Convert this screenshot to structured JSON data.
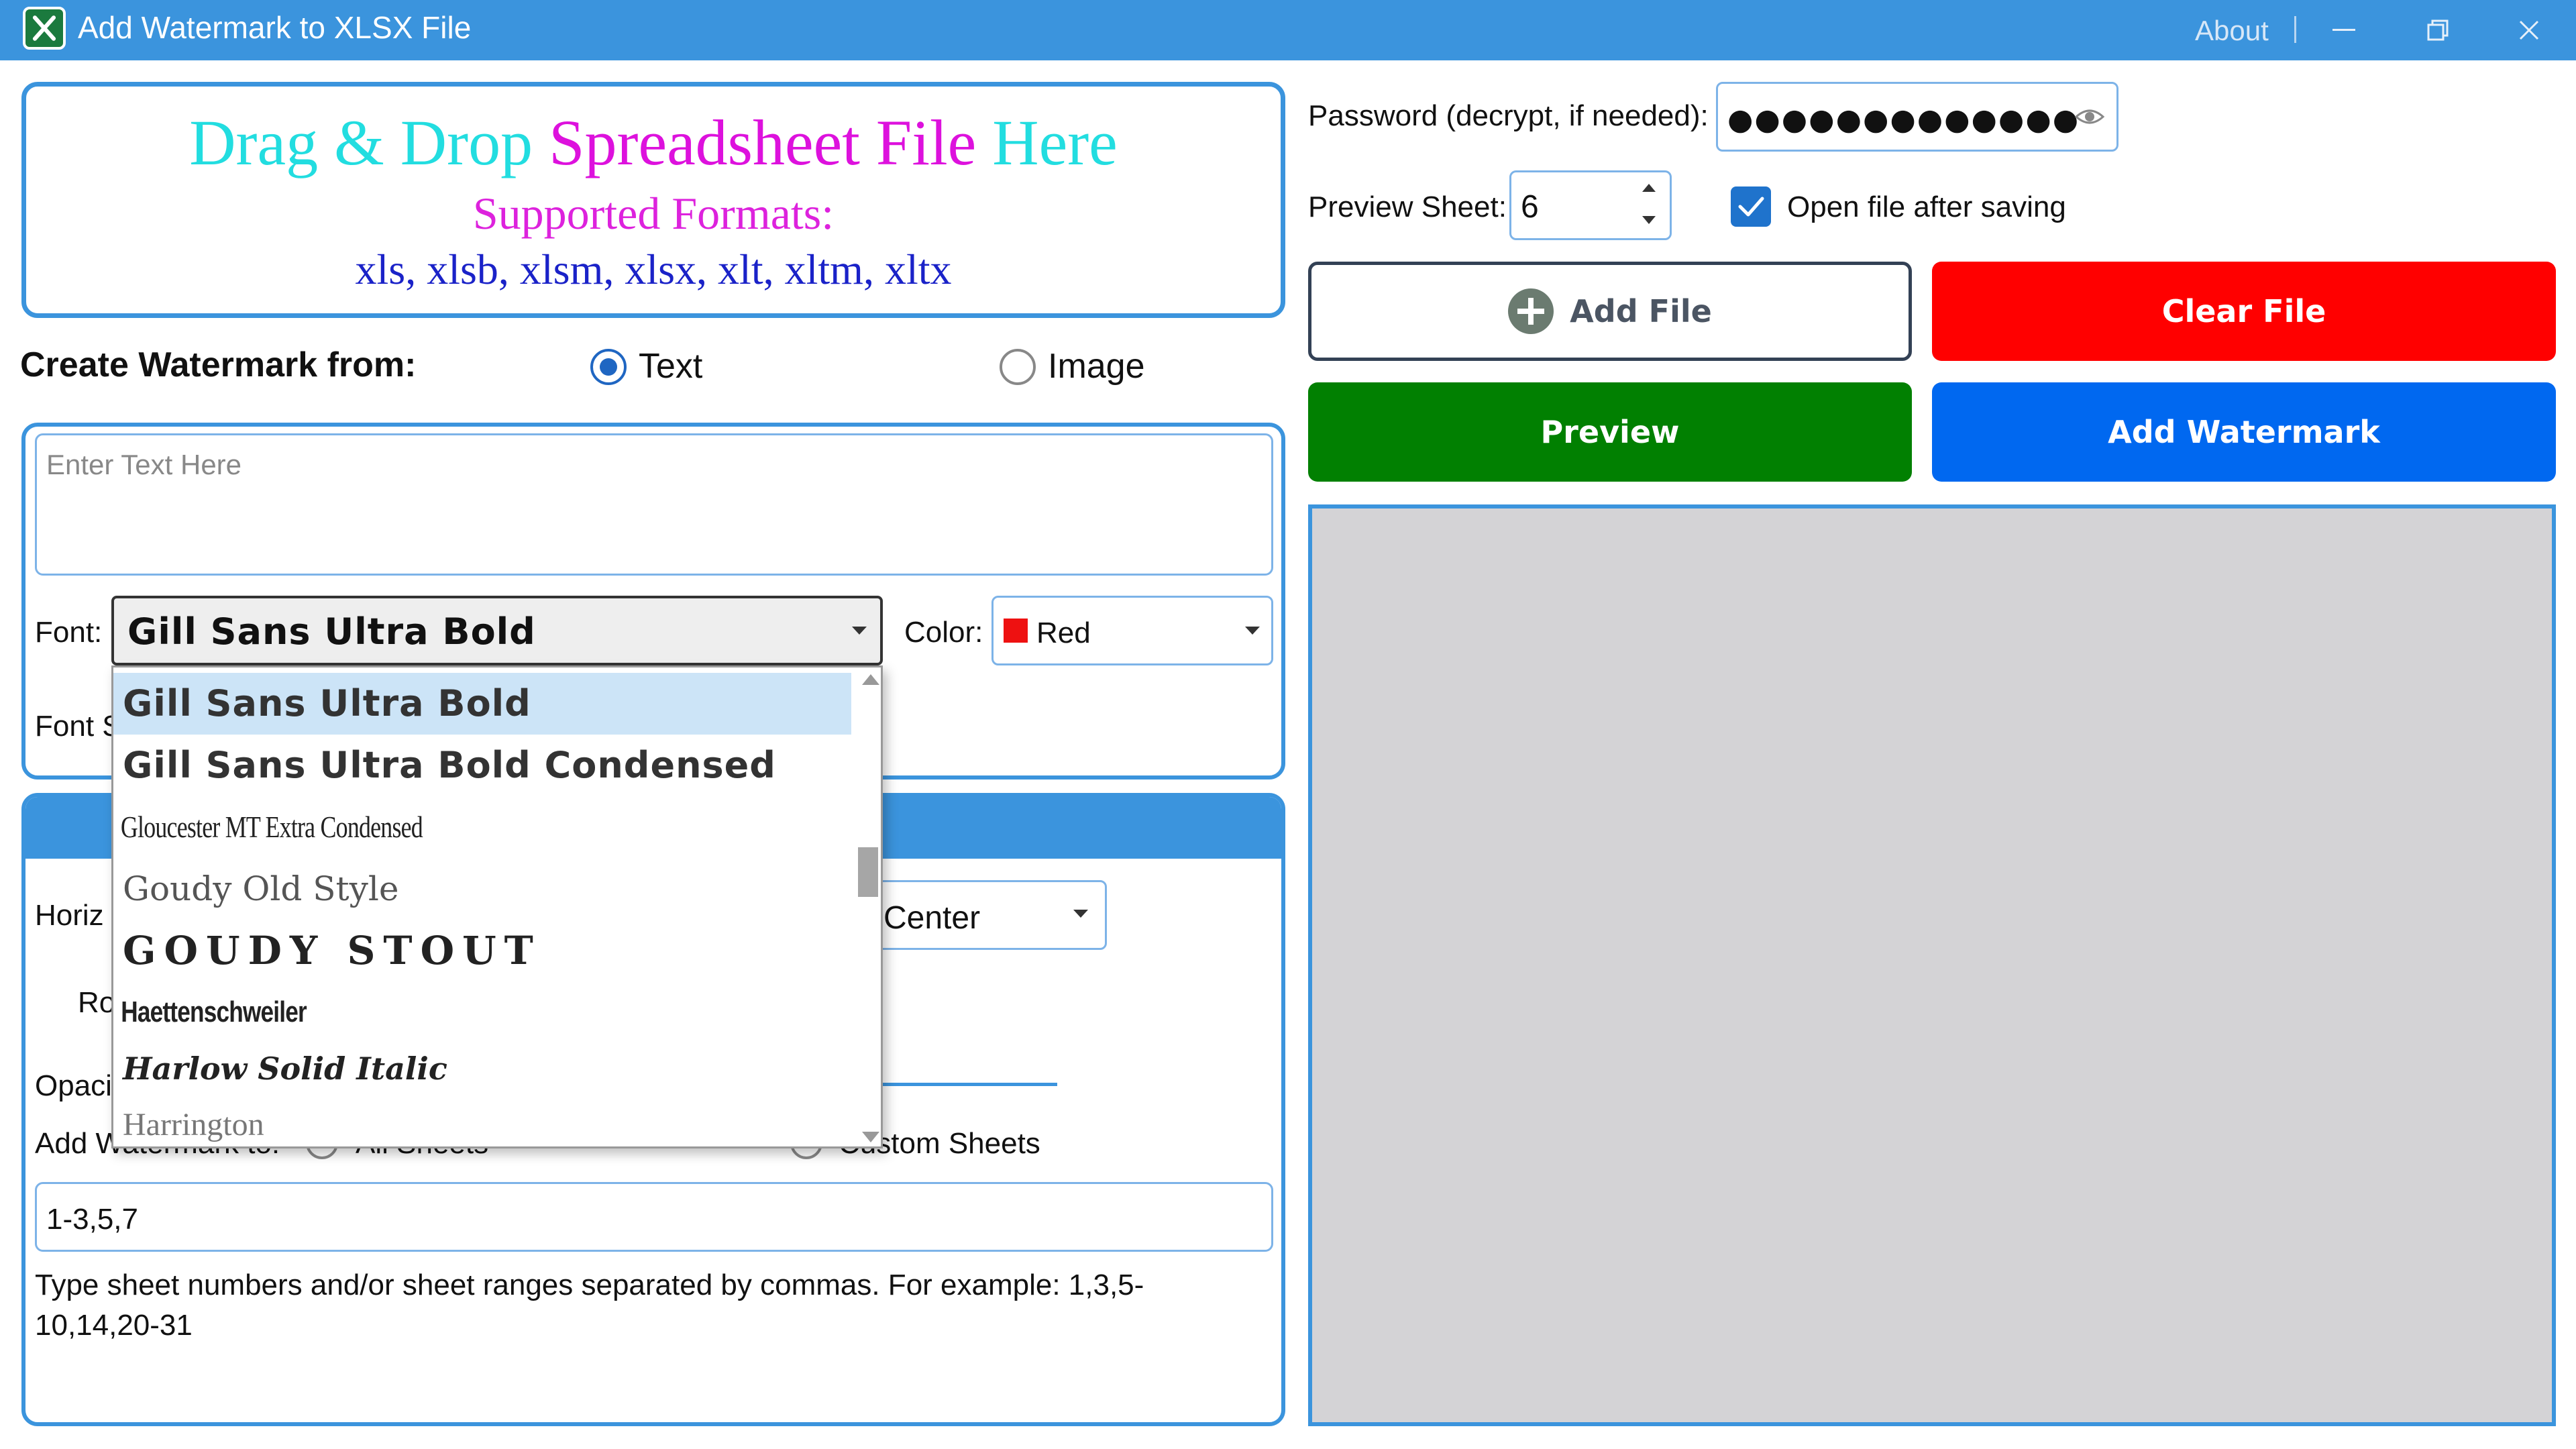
{
  "window": {
    "title": "Add Watermark to XLSX File",
    "about": "About"
  },
  "dropzone": {
    "part_drag": "Drag & Drop",
    "part_file": "Spreadsheet File",
    "part_here": "Here",
    "supported": "Supported Formats:",
    "formats": "xls, xlsb, xlsm, xlsx, xlt, xltm, xltx"
  },
  "watermark_source": {
    "label": "Create Watermark from:",
    "option_text": "Text",
    "option_image": "Image",
    "selected": "Text"
  },
  "text_settings": {
    "text_placeholder": "Enter Text Here",
    "font_label": "Font:",
    "font_value": "Gill Sans Ultra Bold",
    "color_label": "Color:",
    "color_value": "Red",
    "color_swatch": "#ee1111",
    "font_size_label": "Font S"
  },
  "font_dropdown": {
    "items": [
      "Gill Sans Ultra Bold",
      "Gill Sans Ultra Bold Condensed",
      "Gloucester MT Extra Condensed",
      "Goudy Old Style",
      "GOUDY STOUT",
      "Haettenschweiler",
      "Harlow Solid Italic",
      "Harrington"
    ],
    "selected_index": 0
  },
  "layout": {
    "horizontal_label": "Horiz",
    "horizontal_value": "Center",
    "rotation_label": "Ro",
    "opacity_label": "Opaci",
    "add_to_label": "Add Watermark to:",
    "option_all": "All Sheets",
    "option_custom": "Custom Sheets",
    "sheets_value": "1-3,5,7",
    "help_text": "Type sheet numbers and/or sheet ranges separated by commas. For example: 1,3,5-10,14,20-31"
  },
  "right": {
    "password_label": "Password (decrypt, if needed):",
    "password_value": "●●●●●●●●●●●●●",
    "preview_sheet_label": "Preview Sheet:",
    "preview_sheet_value": "6",
    "open_after_label": "Open file after saving",
    "open_after_checked": true,
    "add_file": "Add File",
    "clear_file": "Clear File",
    "preview": "Preview",
    "add_watermark": "Add Watermark"
  },
  "colors": {
    "accent": "#3b94dd",
    "clear": "#ff0000",
    "preview": "#018001",
    "add_watermark": "#0068f0"
  }
}
